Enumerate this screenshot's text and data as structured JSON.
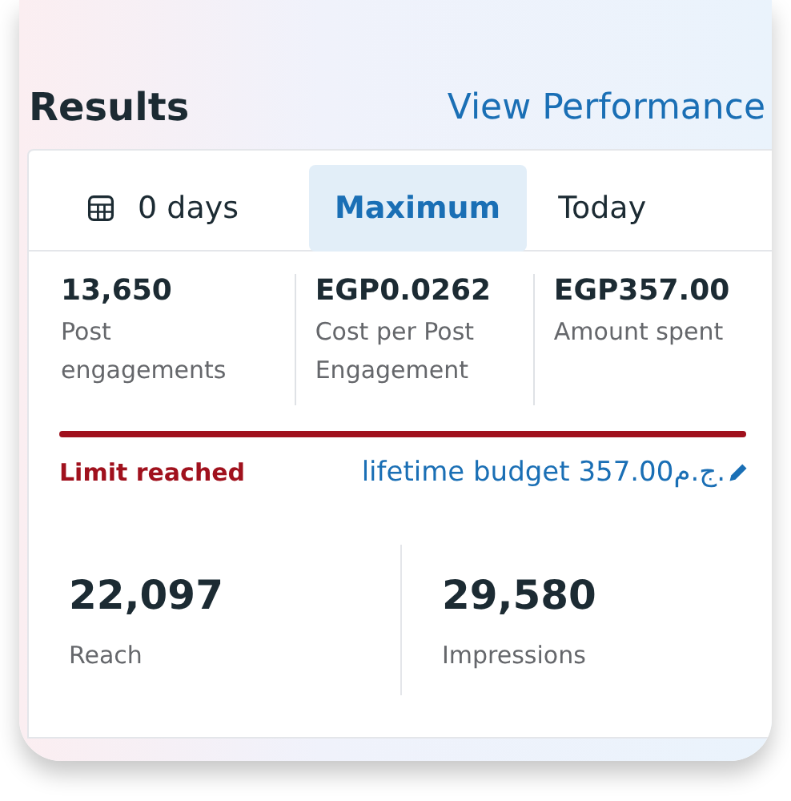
{
  "header": {
    "title": "Results",
    "link": "View Performance"
  },
  "tabs": [
    {
      "label": "0 days",
      "selected": false,
      "icon": true
    },
    {
      "label": "Maximum",
      "selected": true,
      "icon": false
    },
    {
      "label": "Today",
      "selected": false,
      "icon": false
    }
  ],
  "metrics": [
    {
      "value": "13,650",
      "label": "Post engagements"
    },
    {
      "value": "EGP0.0262",
      "label": "Cost per Post Engagement"
    },
    {
      "value": "EGP357.00",
      "label": "Amount spent"
    }
  ],
  "budget": {
    "level": 1,
    "status": "Limit reached",
    "link": "lifetime budget 357.00ج.م."
  },
  "totals": [
    {
      "value": "22,097",
      "label": "Reach"
    },
    {
      "value": "29,580",
      "label": "Impressions"
    }
  ]
}
